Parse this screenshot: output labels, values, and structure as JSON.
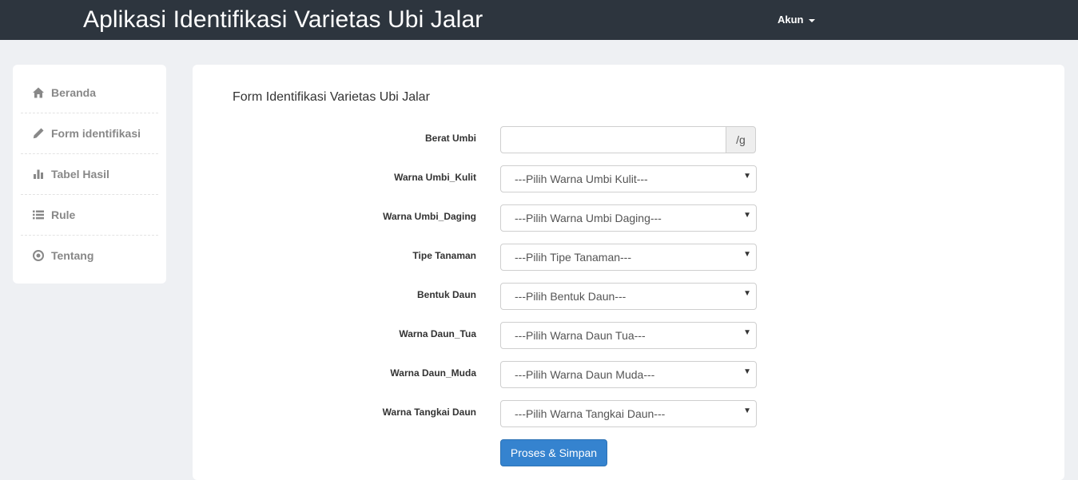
{
  "header": {
    "title": "Aplikasi Identifikasi Varietas Ubi Jalar",
    "account_label": "Akun"
  },
  "sidebar": {
    "items": [
      {
        "label": "Beranda",
        "icon": "home-icon"
      },
      {
        "label": "Form identifikasi",
        "icon": "pencil-icon"
      },
      {
        "label": "Tabel Hasil",
        "icon": "bar-chart-icon"
      },
      {
        "label": "Rule",
        "icon": "list-icon"
      },
      {
        "label": "Tentang",
        "icon": "record-icon"
      }
    ]
  },
  "form": {
    "title": "Form Identifikasi Varietas Ubi Jalar",
    "berat": {
      "label": "Berat Umbi",
      "value": "",
      "addon": "/g"
    },
    "selects": [
      {
        "label": "Warna Umbi_Kulit",
        "value": "---Pilih Warna Umbi Kulit---"
      },
      {
        "label": "Warna Umbi_Daging",
        "value": "---Pilih Warna Umbi Daging---"
      },
      {
        "label": "Tipe Tanaman",
        "value": "---Pilih Tipe Tanaman---"
      },
      {
        "label": "Bentuk Daun",
        "value": "---Pilih Bentuk Daun---"
      },
      {
        "label": "Warna Daun_Tua",
        "value": "---Pilih Warna Daun Tua---"
      },
      {
        "label": "Warna Daun_Muda",
        "value": "---Pilih Warna Daun Muda---"
      },
      {
        "label": "Warna Tangkai Daun",
        "value": "---Pilih Warna Tangkai Daun---"
      }
    ],
    "submit_label": "Proses & Simpan"
  },
  "colors": {
    "navbar": "#2d353e",
    "page_bg": "#eef0f3",
    "primary": "#3583cf"
  }
}
